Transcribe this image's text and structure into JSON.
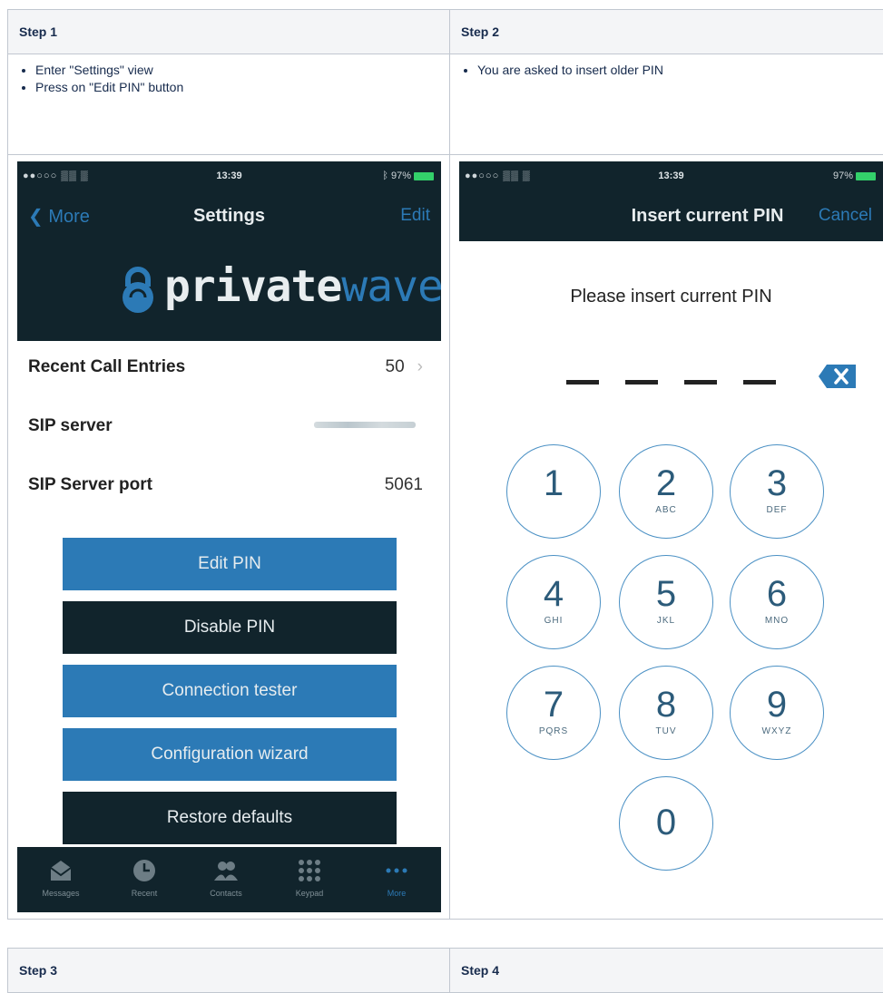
{
  "steps": [
    {
      "title": "Step 1",
      "bullets": [
        "Enter \"Settings\" view",
        "Press on \"Edit PIN\" button"
      ]
    },
    {
      "title": "Step 2",
      "bullets": [
        "You are asked to insert older PIN"
      ]
    },
    {
      "title": "Step 3"
    },
    {
      "title": "Step 4"
    }
  ],
  "phone1": {
    "status_time": "13:39",
    "status_battery": "97%",
    "nav_back": "More",
    "nav_title": "Settings",
    "nav_right": "Edit",
    "logo_part1": "private",
    "logo_part2": "wave",
    "rows": [
      {
        "label": "Recent Call Entries",
        "value": "50"
      },
      {
        "label": "SIP server",
        "value": ""
      },
      {
        "label": "SIP Server port",
        "value": "5061"
      }
    ],
    "buttons": [
      "Edit PIN",
      "Disable PIN",
      "Connection tester",
      "Configuration wizard",
      "Restore defaults"
    ],
    "tabs": [
      {
        "label": "Messages",
        "icon": "envelope-icon"
      },
      {
        "label": "Recent",
        "icon": "clock-icon"
      },
      {
        "label": "Contacts",
        "icon": "contacts-icon"
      },
      {
        "label": "Keypad",
        "icon": "keypad-icon"
      },
      {
        "label": "More",
        "icon": "more-icon"
      }
    ]
  },
  "phone2": {
    "status_time": "13:39",
    "status_battery": "97%",
    "nav_title": "Insert current PIN",
    "nav_right": "Cancel",
    "prompt": "Please insert current PIN",
    "keys": [
      {
        "num": "1",
        "letters": ""
      },
      {
        "num": "2",
        "letters": "ABC"
      },
      {
        "num": "3",
        "letters": "DEF"
      },
      {
        "num": "4",
        "letters": "GHI"
      },
      {
        "num": "5",
        "letters": "JKL"
      },
      {
        "num": "6",
        "letters": "MNO"
      },
      {
        "num": "7",
        "letters": "PQRS"
      },
      {
        "num": "8",
        "letters": "TUV"
      },
      {
        "num": "9",
        "letters": "WXYZ"
      },
      {
        "num": "0",
        "letters": ""
      }
    ]
  },
  "colors": {
    "dark": "#11242c",
    "blue": "#2c7ab6",
    "border": "#c1c7d0"
  }
}
